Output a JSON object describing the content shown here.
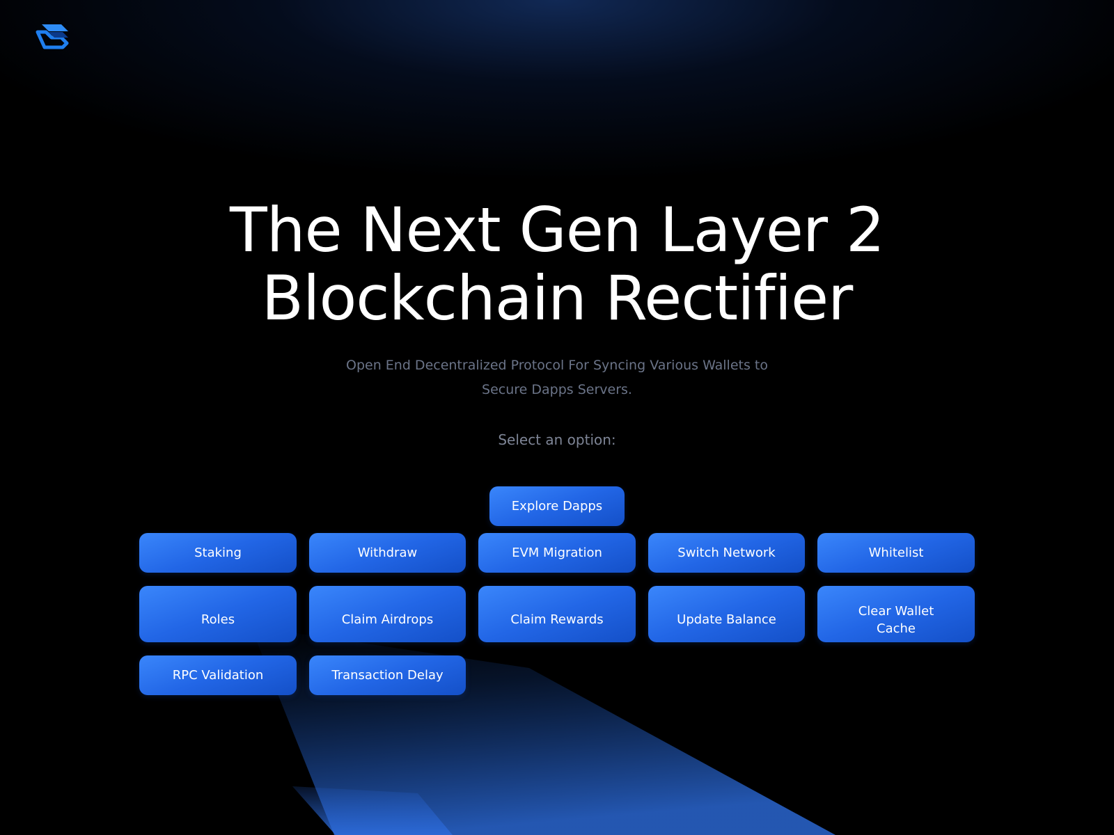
{
  "logo": {
    "icon": "layered-chevron-logo-icon",
    "color": "#2f8cf5"
  },
  "hero": {
    "title_line1": "The Next Gen Layer 2",
    "title_line2": "Blockchain Rectifier",
    "subtitle": "Open End Decentralized Protocol For Syncing Various Wallets to Secure Dapps Servers.",
    "select_label": "Select an option:"
  },
  "buttons": {
    "explore_dapps": "Explore Dapps",
    "staking": "Staking",
    "withdraw": "Withdraw",
    "evm_migration": "EVM Migration",
    "switch_network": "Switch Network",
    "whitelist": "Whitelist",
    "roles": "Roles",
    "claim_airdrops": "Claim Airdrops",
    "claim_rewards": "Claim Rewards",
    "update_balance": "Update Balance",
    "clear_wallet_cache": "Clear Wallet Cache",
    "rpc_validation": "RPC Validation",
    "transaction_delay": "Transaction Delay"
  },
  "colors": {
    "background": "#000000",
    "accent": "#2a6ff0",
    "title": "#ffffff",
    "muted_text": "#6b7488"
  }
}
